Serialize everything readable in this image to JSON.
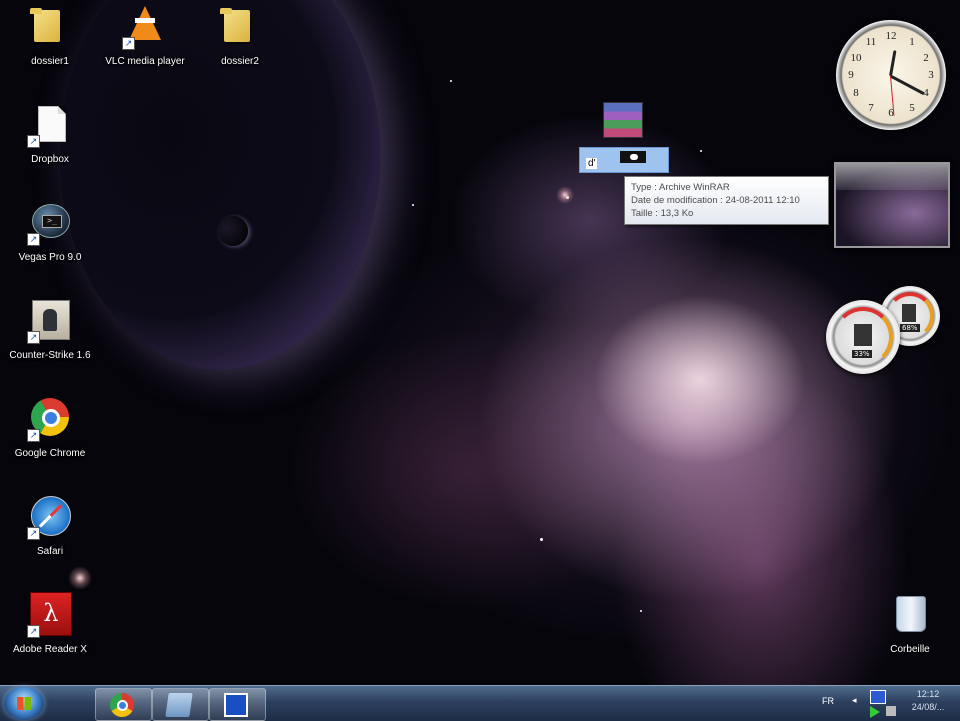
{
  "desktop": {
    "icons": [
      {
        "label": "dossier1",
        "icon": "folder-icon"
      },
      {
        "label": "VLC media player",
        "icon": "vlc-icon"
      },
      {
        "label": "dossier2",
        "icon": "folder-icon"
      },
      {
        "label": "Dropbox",
        "icon": "document-icon"
      },
      {
        "label": "Vegas Pro 9.0",
        "icon": "vegas-pro-icon"
      },
      {
        "label": "Counter-Strike 1.6",
        "icon": "counter-strike-icon"
      },
      {
        "label": "Google Chrome",
        "icon": "chrome-icon"
      },
      {
        "label": "Safari",
        "icon": "safari-icon"
      },
      {
        "label": "Adobe Reader X",
        "icon": "adobe-reader-icon"
      },
      {
        "label": "Corbeille",
        "icon": "recycle-bin-icon"
      }
    ],
    "renaming_file": {
      "icon": "winrar-archive-icon",
      "partial_name": "d'"
    },
    "tooltip": {
      "type_line": "Type : Archive WinRAR",
      "modified_line": "Date de modification : 24-08-2011 12:10",
      "size_line": "Taille : 13,3 Ko"
    }
  },
  "gadgets": {
    "clock_numbers": [
      "12",
      "1",
      "2",
      "3",
      "4",
      "5",
      "6",
      "7",
      "8",
      "9",
      "10",
      "11"
    ],
    "cpu_meter": {
      "big_pct": "33%",
      "small_pct": "68%"
    }
  },
  "taskbar": {
    "buttons": [
      "chrome-icon",
      "explorer-icon",
      "screen-capture-icon"
    ],
    "language": "FR",
    "time": "12:12",
    "date": "24/08/..."
  },
  "colors": {
    "taskbar_top": "#506b8c",
    "selection": "#9fc3ef",
    "tooltip_bg": "#ffffff"
  }
}
